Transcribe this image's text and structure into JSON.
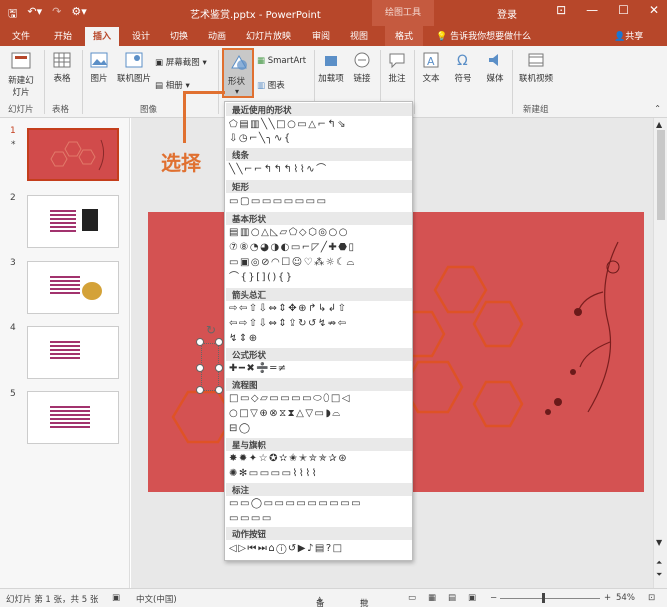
{
  "titlebar": {
    "title": "艺术鉴赏.pptx - PowerPoint",
    "context_tab": "绘图工具",
    "login": "登录",
    "qat": [
      "save-icon",
      "undo-icon",
      "redo-icon",
      "customize-icon"
    ]
  },
  "tabs": {
    "items": [
      "文件",
      "开始",
      "插入",
      "设计",
      "切换",
      "动画",
      "幻灯片放映",
      "审阅",
      "视图"
    ],
    "format": "格式",
    "tell_me": "告诉我你想要做什么",
    "share": "共享"
  },
  "ribbon": {
    "new_slide": "新建幻灯片",
    "table": "表格",
    "picture": "图片",
    "online_picture": "联机图片",
    "screenshot": "屏幕截图",
    "album": "相册",
    "shapes": "形状",
    "smartart": "SmartArt",
    "chart": "图表",
    "addins": "加载项",
    "link": "链接",
    "comment": "批注",
    "text": "文本",
    "symbol": "符号",
    "media": "媒体",
    "online_video": "联机视频",
    "groups": {
      "slides": "幻灯片",
      "tables": "表格",
      "images": "图像",
      "new_group": "新建组"
    }
  },
  "gallery": {
    "sections": [
      {
        "title": "最近使用的形状",
        "rows": [
          "⬠▤▥╲╲□○▭△⌐↰⇘",
          "⇩◷⌐╲╮∿{"
        ]
      },
      {
        "title": "线条",
        "rows": [
          "╲╲⌐⌐↰↰↰⌇⌇∿⌒"
        ]
      },
      {
        "title": "矩形",
        "rows": [
          "▭▢▭▭▭▭▭▭▭"
        ]
      },
      {
        "title": "基本形状",
        "rows": [
          "▤▥○△◺▱⬠◇⬡◎○○",
          "⑦⑧◔◕◑◐▭⌐◸╱✚⬣▯",
          "▭▣◎⊘◠☐☺♡⁂☼☾⌓",
          "⌒{}[](){}",
          ""
        ]
      },
      {
        "title": "箭头总汇",
        "rows": [
          "⇨⇦⇧⇩⇔⇕✥⊕↱↳↲⇧",
          "⇦⇨⇧⇩⇔⇕⇪↻↺↯⇏⇦",
          "↯⇕⊕"
        ]
      },
      {
        "title": "公式形状",
        "rows": [
          "✚━✖➗═≠"
        ]
      },
      {
        "title": "流程图",
        "rows": [
          "□▭◇▱▭▭▭▭⬭⬯□◁",
          "○□▽⊕⊗⧖⧗△▽▭◗⌓",
          "⊟◯"
        ]
      },
      {
        "title": "星与旗帜",
        "rows": [
          "✸✹✦☆✪✫✬✭✮✯✰⊛",
          "✺✻▭▭▭▭⌇⌇⌇⌇"
        ]
      },
      {
        "title": "标注",
        "rows": [
          "▭▭◯▭▭▭▭▭▭▭▭▭",
          "▭▭▭▭"
        ]
      },
      {
        "title": "动作按钮",
        "rows": [
          "◁▷⏮⏭⌂ⓘ↺▶♪▤?□"
        ]
      }
    ]
  },
  "callout": {
    "text": "选择"
  },
  "slides": [
    {
      "number": "1",
      "star": "*"
    },
    {
      "number": "2"
    },
    {
      "number": "3"
    },
    {
      "number": "4"
    },
    {
      "number": "5"
    }
  ],
  "status": {
    "slide_info": "幻灯片 第 1 张，共 5 张",
    "language": "中文(中国)",
    "notes": "备注",
    "comments": "批注",
    "zoom": "54%"
  },
  "colors": {
    "accent": "#b7472a",
    "slide_bg": "#d45252",
    "callout": "#e07030"
  }
}
